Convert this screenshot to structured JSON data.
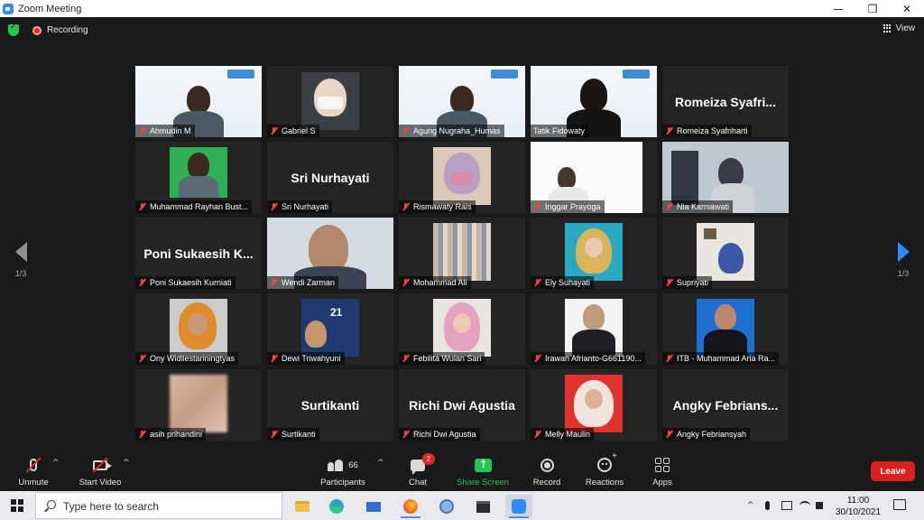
{
  "window": {
    "title": "Zoom Meeting",
    "controls": [
      "—",
      "❐",
      "✕"
    ]
  },
  "meeting": {
    "recording_label": "Recording",
    "view_label": "View"
  },
  "pagination": {
    "left": "1/3",
    "right": "1/3"
  },
  "participants": [
    {
      "name": "Ahmudin M",
      "display": "",
      "muted": true
    },
    {
      "name": "Gabriel S",
      "display": "",
      "muted": true
    },
    {
      "name": "Agung Nugraha_Humas",
      "display": "",
      "muted": true
    },
    {
      "name": "Tatik Fidowaty",
      "display": "",
      "muted": false,
      "active": true
    },
    {
      "name": "Romeiza Syafriharti",
      "display": "Romeiza Syafri...",
      "muted": true
    },
    {
      "name": "Muhammad Rayhan Bust...",
      "display": "",
      "muted": true
    },
    {
      "name": "Sri Nurhayati",
      "display": "Sri Nurhayati",
      "muted": true
    },
    {
      "name": "Rismawaty Rais",
      "display": "",
      "muted": true
    },
    {
      "name": "Inggar Prayoga",
      "display": "",
      "muted": true
    },
    {
      "name": "Nia Karniawati",
      "display": "",
      "muted": true
    },
    {
      "name": "Poni Sukaesih Kurniati",
      "display": "Poni Sukaesih K...",
      "muted": true
    },
    {
      "name": "Wendi Zarman",
      "display": "",
      "muted": true
    },
    {
      "name": "Mohammad Ali",
      "display": "",
      "muted": true
    },
    {
      "name": "Ely Suhayati",
      "display": "",
      "muted": true
    },
    {
      "name": "Supriyati",
      "display": "",
      "muted": true
    },
    {
      "name": "Ony Widilestariningtyas",
      "display": "",
      "muted": true
    },
    {
      "name": "Dewi Triwahyuni",
      "display": "",
      "muted": true
    },
    {
      "name": "Febilita Wulan Sari",
      "display": "",
      "muted": true
    },
    {
      "name": "Irawan Afrianto-G661190...",
      "display": "",
      "muted": true
    },
    {
      "name": "ITB - Muhammad Aria Ra...",
      "display": "",
      "muted": true
    },
    {
      "name": "asih prihandini",
      "display": "",
      "muted": true
    },
    {
      "name": "Surtikanti",
      "display": "Surtikanti",
      "muted": true
    },
    {
      "name": "Richi Dwi Agustia",
      "display": "Richi Dwi Agustia",
      "muted": true
    },
    {
      "name": "Melly Maulin",
      "display": "",
      "muted": true
    },
    {
      "name": "Angky Febriansyah",
      "display": "Angky Febrians...",
      "muted": true
    }
  ],
  "toolbar": {
    "unmute": "Unmute",
    "start_video": "Start Video",
    "participants": "Participants",
    "participants_count": "66",
    "chat": "Chat",
    "chat_badge": "2",
    "share_screen": "Share Screen",
    "record": "Record",
    "reactions": "Reactions",
    "apps": "Apps",
    "leave": "Leave"
  },
  "taskbar": {
    "search_placeholder": "Type here to search",
    "time": "11:00",
    "date": "30/10/2021"
  },
  "colors": {
    "accent": "#2d8cff",
    "share": "#23c552",
    "leave": "#d9221e",
    "active_speaker": "#d6e33a"
  }
}
